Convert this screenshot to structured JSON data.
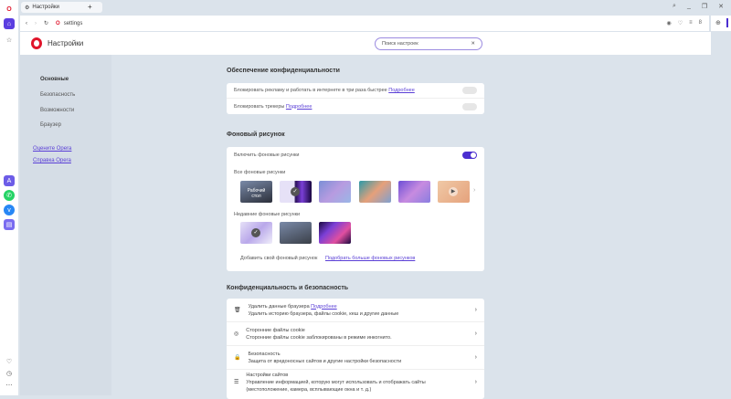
{
  "tab": {
    "title": "Настройки",
    "new_tab": "+"
  },
  "address": {
    "url": "settings"
  },
  "window": {
    "search": "⌕",
    "minimize": "_",
    "restore": "❐",
    "close": "✕"
  },
  "header": {
    "title": "Настройки",
    "search_placeholder": "Поиск настроек",
    "clear": "✕"
  },
  "nav": {
    "items": [
      "Основные",
      "Безопасность",
      "Возможности",
      "Браузер"
    ],
    "links": [
      "Оцените Opera",
      "Справка Opera"
    ]
  },
  "privacy": {
    "title": "Обеспечение конфиденциальности",
    "rows": [
      {
        "label": "Блокировать рекламу и работать в интернете в три раза быстрее",
        "link": "Подробнее",
        "on": false
      },
      {
        "label": "Блокировать трекеры",
        "link": "Подробнее",
        "on": false
      }
    ]
  },
  "wallpaper": {
    "title": "Фоновый рисунок",
    "enable": "Включить фоновые рисунки",
    "enabled": true,
    "all": "Все фоновые рисунки",
    "desktop_label": "Рабочий стол",
    "recent": "Недавние фоновые рисунки",
    "add": "Добавить свой фоновый рисунок",
    "more": "Подобрать больше фоновых рисунков"
  },
  "security": {
    "title": "Конфиденциальность и безопасность",
    "rows": [
      {
        "title": "Удалить данные браузера",
        "link": "Подробнее",
        "desc": "Удалить историю браузера, файлы cookie, кеш и другие данные",
        "icon": "trash-icon"
      },
      {
        "title": "Сторонние файлы cookie",
        "desc": "Сторонние файлы cookie заблокированы в режиме инкогнито.",
        "icon": "cookie-icon"
      },
      {
        "title": "Безопасность",
        "desc": "Защита от вредоносных сайтов и другие настройки безопасности",
        "icon": "lock-icon"
      },
      {
        "title": "Настройки сайтов",
        "desc": "Управление информацией, которую могут использовать и отображать сайты (местоположение, камера, всплывающие окна и т. д.)",
        "icon": "sliders-icon"
      }
    ]
  },
  "colors": {
    "accent": "#4b2fd0",
    "opera_red": "#e0152b"
  }
}
